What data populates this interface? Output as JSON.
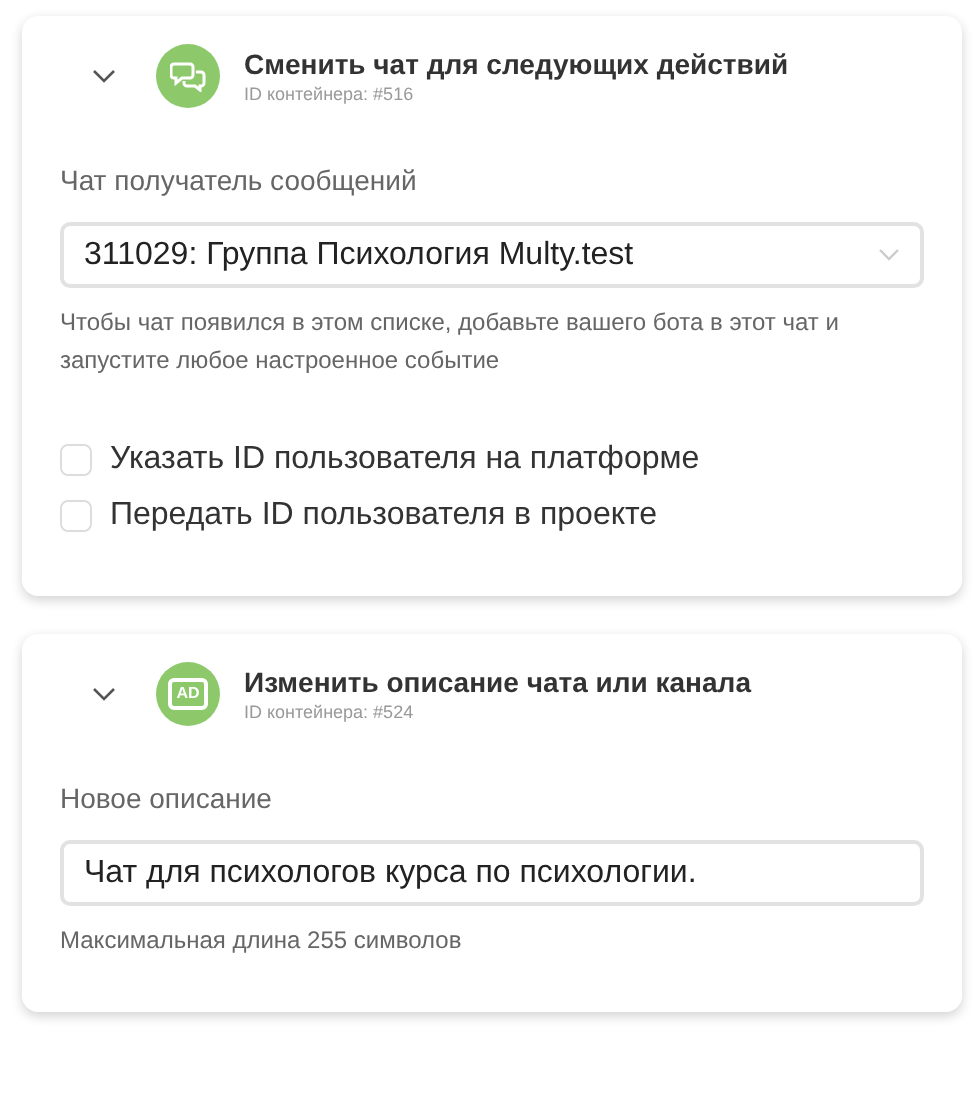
{
  "cards": [
    {
      "title": "Сменить чат для следующих действий",
      "container_id": "ID контейнера: #516",
      "icon": {
        "kind": "chat"
      },
      "expanded": true,
      "fields": [
        {
          "kind": "select",
          "label": "Чат получатель сообщений",
          "value": "311029: Группа Психология Multy.test",
          "hint": "Чтобы чат появился в этом списке, добавьте вашего бота в этот чат и запустите любое настроенное событие"
        },
        {
          "kind": "checkbox",
          "label": "Указать ID пользователя на платформе",
          "checked": false
        },
        {
          "kind": "checkbox",
          "label": "Передать ID пользователя в проекте",
          "checked": false
        }
      ]
    },
    {
      "title": "Изменить описание чата или канала",
      "container_id": "ID контейнера: #524",
      "icon": {
        "kind": "tag",
        "text": "AD"
      },
      "expanded": true,
      "fields": [
        {
          "kind": "text",
          "label": "Новое описание",
          "value": "Чат для психологов курса по психологии.",
          "hint": "Максимальная длина 255 символов"
        }
      ]
    }
  ]
}
